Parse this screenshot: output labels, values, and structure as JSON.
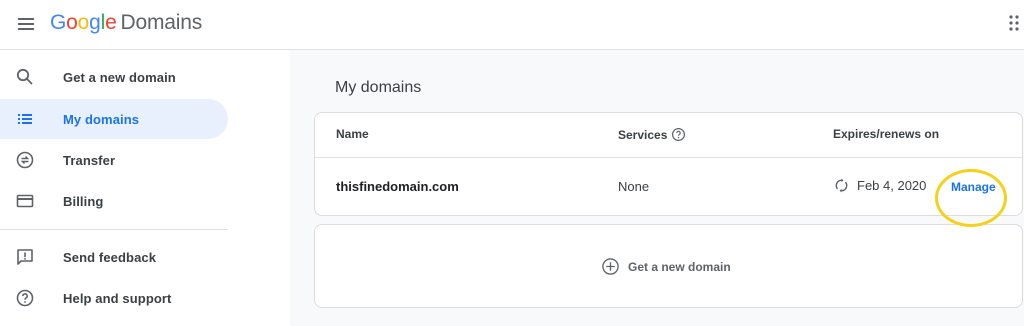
{
  "header": {
    "logo_google": [
      "G",
      "o",
      "o",
      "g",
      "l",
      "e"
    ],
    "logo_product": "Domains",
    "brand_colors": [
      "#4285F4",
      "#EA4335",
      "#FBBC05",
      "#4285F4",
      "#34A853",
      "#EA4335"
    ]
  },
  "sidebar": {
    "items": [
      {
        "label": "Get a new domain",
        "icon": "search-icon"
      },
      {
        "label": "My domains",
        "icon": "list-icon",
        "active": true
      },
      {
        "label": "Transfer",
        "icon": "transfer-icon"
      },
      {
        "label": "Billing",
        "icon": "credit-card-icon"
      },
      {
        "label": "Send feedback",
        "icon": "feedback-icon"
      },
      {
        "label": "Help and support",
        "icon": "help-icon"
      }
    ]
  },
  "main": {
    "title": "My domains",
    "table": {
      "columns": [
        "Name",
        "Services",
        "Expires/renews on"
      ],
      "rows": [
        {
          "name": "thisfinedomain.com",
          "services": "None",
          "expires": "Feb 4, 2020",
          "action": "Manage"
        }
      ]
    },
    "get_new_domain": "Get a new domain"
  },
  "colors": {
    "accent": "#1a73e8",
    "active_bg": "#e8f0fe",
    "highlight": "#f4d11b"
  }
}
